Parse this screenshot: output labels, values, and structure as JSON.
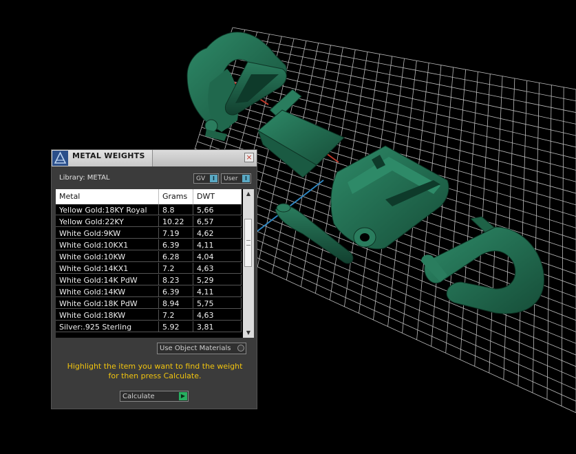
{
  "panel": {
    "title": "METAL WEIGHTS",
    "close_icon": "×",
    "library_label": "Library: METAL",
    "toggles": [
      {
        "label": "GV",
        "indicator": "I"
      },
      {
        "label": "User",
        "indicator": "I"
      }
    ],
    "columns": [
      "Metal",
      "Grams",
      "DWT"
    ],
    "rows": [
      {
        "metal": "Yellow Gold:18KY Royal",
        "grams": "8.8",
        "dwt": "5,66"
      },
      {
        "metal": "Yellow Gold:22KY",
        "grams": "10.22",
        "dwt": "6,57"
      },
      {
        "metal": "White Gold:9KW",
        "grams": "7.19",
        "dwt": "4,62"
      },
      {
        "metal": "White Gold:10KX1",
        "grams": "6.39",
        "dwt": "4,11"
      },
      {
        "metal": "White Gold:10KW",
        "grams": "6.28",
        "dwt": "4,04"
      },
      {
        "metal": "White Gold:14KX1",
        "grams": "7.2",
        "dwt": "4,63"
      },
      {
        "metal": "White Gold:14K PdW",
        "grams": "8.23",
        "dwt": "5,29"
      },
      {
        "metal": "White Gold:14KW",
        "grams": "6.39",
        "dwt": "4,11"
      },
      {
        "metal": "White Gold:18K PdW",
        "grams": "8.94",
        "dwt": "5,75"
      },
      {
        "metal": "White Gold:18KW",
        "grams": "7.2",
        "dwt": "4,63"
      },
      {
        "metal": "Silver:.925 Sterling",
        "grams": "5.92",
        "dwt": "3,81"
      }
    ],
    "use_object_materials_label": "Use Object Materials",
    "hint_line1": "Highlight the item you want to find the weight",
    "hint_line2": "for then press Calculate.",
    "calculate_label": "Calculate",
    "calculate_indicator": "▶"
  },
  "colors": {
    "model_green": "#1f6b4f",
    "hint_yellow": "#f1c40f",
    "toggle_accent": "#5aa9c4",
    "calculate_accent": "#27ae60"
  }
}
